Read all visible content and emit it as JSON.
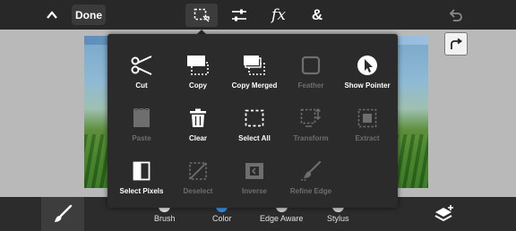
{
  "topbar": {
    "done_label": "Done",
    "fx_label": "fx",
    "amp_label": "&"
  },
  "menu": {
    "items": [
      {
        "label": "Cut",
        "icon": "scissors-icon",
        "enabled": true
      },
      {
        "label": "Copy",
        "icon": "copy-icon",
        "enabled": true
      },
      {
        "label": "Copy Merged",
        "icon": "copy-merged-icon",
        "enabled": true
      },
      {
        "label": "Feather",
        "icon": "feather-icon",
        "enabled": false
      },
      {
        "label": "Show Pointer",
        "icon": "pointer-icon",
        "enabled": true
      },
      {
        "label": "Paste",
        "icon": "paste-icon",
        "enabled": false
      },
      {
        "label": "Clear",
        "icon": "trash-icon",
        "enabled": true
      },
      {
        "label": "Select All",
        "icon": "select-all-icon",
        "enabled": true
      },
      {
        "label": "Transform",
        "icon": "transform-icon",
        "enabled": false
      },
      {
        "label": "Extract",
        "icon": "extract-icon",
        "enabled": false
      },
      {
        "label": "Select Pixels",
        "icon": "select-pixels-icon",
        "enabled": true
      },
      {
        "label": "Deselect",
        "icon": "deselect-icon",
        "enabled": false
      },
      {
        "label": "Inverse",
        "icon": "inverse-icon",
        "enabled": false
      },
      {
        "label": "Refine Edge",
        "icon": "refine-edge-icon",
        "enabled": false
      }
    ]
  },
  "bottombar": {
    "options": [
      {
        "label": "Brush"
      },
      {
        "label": "Color"
      },
      {
        "label": "Edge Aware"
      },
      {
        "label": "Stylus"
      }
    ]
  },
  "colors": {
    "topbar_bg": "#282828",
    "popup_bg": "#2b2b2b",
    "disabled_text": "#6e6e6e",
    "color_swatch": "#3a8fe0"
  }
}
